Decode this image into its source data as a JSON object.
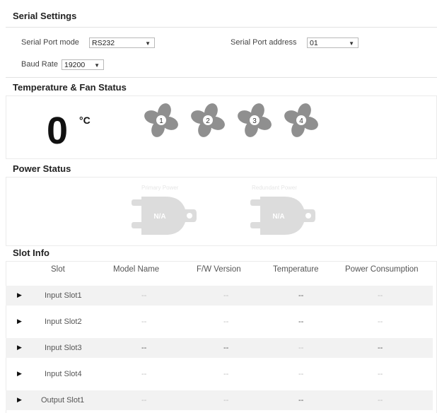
{
  "serial": {
    "title": "Serial Settings",
    "mode_label": "Serial Port mode",
    "mode_value": "RS232",
    "address_label": "Serial Port address",
    "address_value": "01",
    "baud_label": "Baud Rate",
    "baud_value": "19200"
  },
  "temp_fan": {
    "title": "Temperature & Fan Status",
    "temperature": "0",
    "unit": "°C",
    "fans": [
      "1",
      "2",
      "3",
      "4"
    ]
  },
  "power": {
    "title": "Power Status",
    "psu_labels": [
      "Primary Power",
      "Redundant Power"
    ],
    "psu_text": "N/A"
  },
  "slot_info": {
    "title": "Slot Info",
    "headers": [
      "Slot",
      "Model Name",
      "F/W Version",
      "Temperature",
      "Power Consumption"
    ],
    "rows": [
      {
        "slot": "Input Slot1",
        "model": "--",
        "fw": "--",
        "temp": "--",
        "power": "--"
      },
      {
        "slot": "Input Slot2",
        "model": "--",
        "fw": "--",
        "temp": "--",
        "power": "--"
      },
      {
        "slot": "Input Slot3",
        "model": "--",
        "fw": "--",
        "temp": "--",
        "power": "--"
      },
      {
        "slot": "Input Slot4",
        "model": "--",
        "fw": "--",
        "temp": "--",
        "power": "--"
      },
      {
        "slot": "Output Slot1",
        "model": "--",
        "fw": "--",
        "temp": "--",
        "power": "--"
      }
    ]
  },
  "colors": {
    "fan": "#8f8f8f",
    "psu": "#dcdcdc",
    "row_alt": "#f2f2f2"
  },
  "icons": {
    "fan": "fan-icon",
    "psu": "power-supply-icon",
    "expand": "play-arrow-icon"
  }
}
